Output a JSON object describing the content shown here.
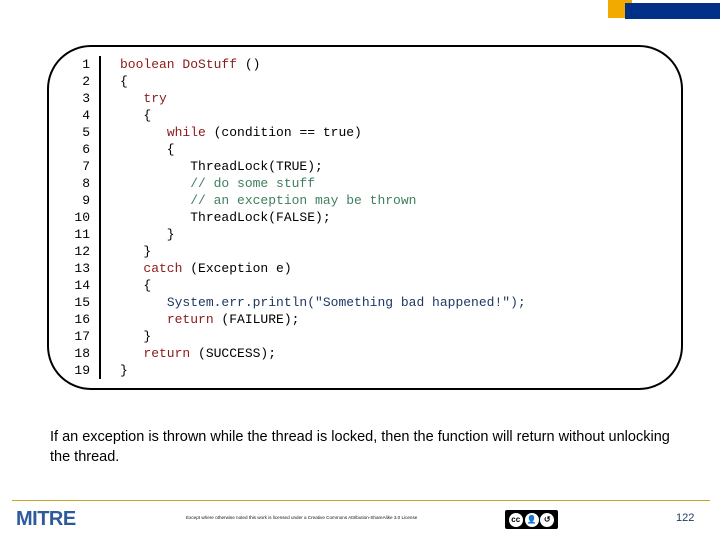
{
  "slide": {
    "page_number": "122",
    "accent_amber": "#F2A900",
    "accent_navy": "#003087"
  },
  "code_block": {
    "line_numbers": [
      "1",
      "2",
      "3",
      "4",
      "5",
      "6",
      "7",
      "8",
      "9",
      "10",
      "11",
      "12",
      "13",
      "14",
      "15",
      "16",
      "17",
      "18",
      "19"
    ],
    "lines": [
      {
        "n": "1",
        "segments": [
          {
            "t": "boolean",
            "c": "kwr"
          },
          {
            "t": " ",
            "c": "plain"
          },
          {
            "t": "DoStuff",
            "c": "kwr"
          },
          {
            "t": " ()",
            "c": "plain"
          }
        ]
      },
      {
        "n": "2",
        "segments": [
          {
            "t": "{",
            "c": "plain"
          }
        ]
      },
      {
        "n": "3",
        "segments": [
          {
            "t": "   ",
            "c": "plain"
          },
          {
            "t": "try",
            "c": "kwr"
          }
        ]
      },
      {
        "n": "4",
        "segments": [
          {
            "t": "   {",
            "c": "plain"
          }
        ]
      },
      {
        "n": "5",
        "segments": [
          {
            "t": "      ",
            "c": "plain"
          },
          {
            "t": "while",
            "c": "kwr"
          },
          {
            "t": " (condition == true)",
            "c": "plain"
          }
        ]
      },
      {
        "n": "6",
        "segments": [
          {
            "t": "      {",
            "c": "plain"
          }
        ]
      },
      {
        "n": "7",
        "segments": [
          {
            "t": "         ThreadLock(TRUE);",
            "c": "plain"
          }
        ]
      },
      {
        "n": "8",
        "segments": [
          {
            "t": "         ",
            "c": "plain"
          },
          {
            "t": "// do some stuff",
            "c": "cmt"
          }
        ]
      },
      {
        "n": "9",
        "segments": [
          {
            "t": "         ",
            "c": "plain"
          },
          {
            "t": "// an exception may be thrown",
            "c": "cmt"
          }
        ]
      },
      {
        "n": "10",
        "segments": [
          {
            "t": "         ThreadLock(FALSE);",
            "c": "plain"
          }
        ]
      },
      {
        "n": "11",
        "segments": [
          {
            "t": "      }",
            "c": "plain"
          }
        ]
      },
      {
        "n": "12",
        "segments": [
          {
            "t": "   }",
            "c": "plain"
          }
        ]
      },
      {
        "n": "13",
        "segments": [
          {
            "t": "   ",
            "c": "plain"
          },
          {
            "t": "catch",
            "c": "kwr"
          },
          {
            "t": " (Exception e)",
            "c": "plain"
          }
        ]
      },
      {
        "n": "14",
        "segments": [
          {
            "t": "   {",
            "c": "plain"
          }
        ]
      },
      {
        "n": "15",
        "segments": [
          {
            "t": "      ",
            "c": "plain"
          },
          {
            "t": "System.err.println(\"Something bad happened!\");",
            "c": "blu"
          }
        ]
      },
      {
        "n": "16",
        "segments": [
          {
            "t": "      ",
            "c": "plain"
          },
          {
            "t": "return",
            "c": "kwr"
          },
          {
            "t": " (FAILURE);",
            "c": "plain"
          }
        ]
      },
      {
        "n": "17",
        "segments": [
          {
            "t": "   }",
            "c": "plain"
          }
        ]
      },
      {
        "n": "18",
        "segments": [
          {
            "t": "   ",
            "c": "plain"
          },
          {
            "t": "return",
            "c": "kwr"
          },
          {
            "t": " (SUCCESS);",
            "c": "plain"
          }
        ]
      },
      {
        "n": "19",
        "segments": [
          {
            "t": "}",
            "c": "plain"
          }
        ]
      }
    ],
    "plain_text": "boolean DoStuff ()\n{\n   try\n   {\n      while (condition == true)\n      {\n         ThreadLock(TRUE);\n         // do some stuff\n         // an exception may be thrown\n         ThreadLock(FALSE);\n      }\n   }\n   catch (Exception e)\n   {\n      System.err.println(\"Something bad happened!\");\n      return (FAILURE);\n   }\n   return (SUCCESS);\n}"
  },
  "caption": {
    "text": "If an exception is thrown while the thread is locked, then the function will return without unlocking the thread."
  },
  "footer": {
    "logo_text": "MITRE",
    "license_text": "Except where otherwise noted this work is licensed under a Creative Commons Attribution-ShareAlike 3.0 License",
    "cc_marks": [
      "cc",
      "BY",
      "SA"
    ],
    "page_number": "122"
  }
}
